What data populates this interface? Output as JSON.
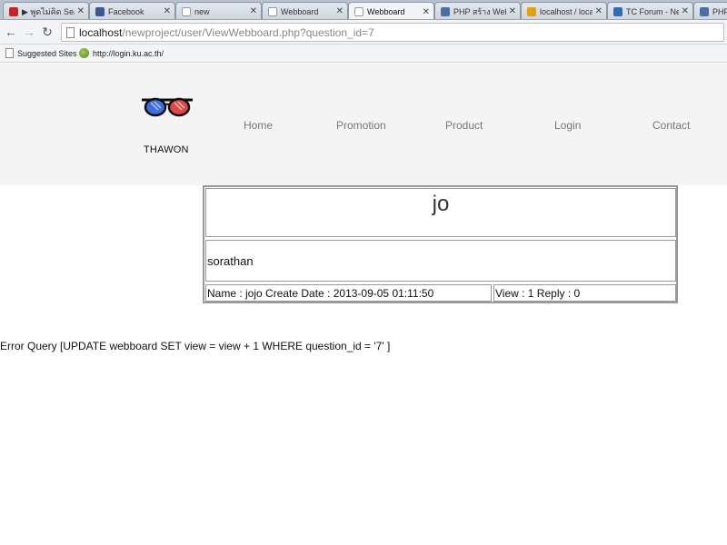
{
  "browser": {
    "tabs": [
      {
        "title": "▶ พูดไม่คิด Sea",
        "icon": "youtube-icon",
        "color": "#cc2222",
        "active": false
      },
      {
        "title": "Facebook",
        "icon": "facebook-icon",
        "color": "#3b5998",
        "active": false
      },
      {
        "title": "new",
        "icon": "page-icon",
        "color": "#ffffff",
        "active": false
      },
      {
        "title": "Webboard",
        "icon": "page-icon",
        "color": "#ffffff",
        "active": false
      },
      {
        "title": "Webboard",
        "icon": "page-icon",
        "color": "#ffffff",
        "active": true
      },
      {
        "title": "PHP สร้าง WebB",
        "icon": "php-icon",
        "color": "#4a6fa5",
        "active": false
      },
      {
        "title": "localhost / loca",
        "icon": "phpmyadmin-icon",
        "color": "#e8a000",
        "active": false
      },
      {
        "title": "TC Forum - Ne",
        "icon": "tc-forum-icon",
        "color": "#2e6cb8",
        "active": false
      },
      {
        "title": "PHP",
        "icon": "php-icon",
        "color": "#4a6fa5",
        "active": false
      }
    ],
    "url_host": "localhost",
    "url_path": "/newproject/user/ViewWebboard.php?question_id=7",
    "bookmarks": [
      {
        "label": "Suggested Sites",
        "icon": "page-icon"
      },
      {
        "label": "http://login.ku.ac.th/",
        "icon": "globe-icon"
      }
    ]
  },
  "site": {
    "brand": "THAWON",
    "nav": [
      "Home",
      "Promotion",
      "Product",
      "Login",
      "Contact"
    ]
  },
  "question": {
    "title": "jo",
    "detail": "sorathan",
    "meta": "Name : jojo Create Date : 2013-09-05 01:11:50",
    "stats": "View : 1 Reply : 0"
  },
  "error_text": "Error Query [UPDATE webboard SET view = view + 1 WHERE question_id = '7' ]",
  "colors": {
    "header_bg": "#f4f4f4",
    "nav_text": "#777777",
    "table_border": "#999999"
  }
}
